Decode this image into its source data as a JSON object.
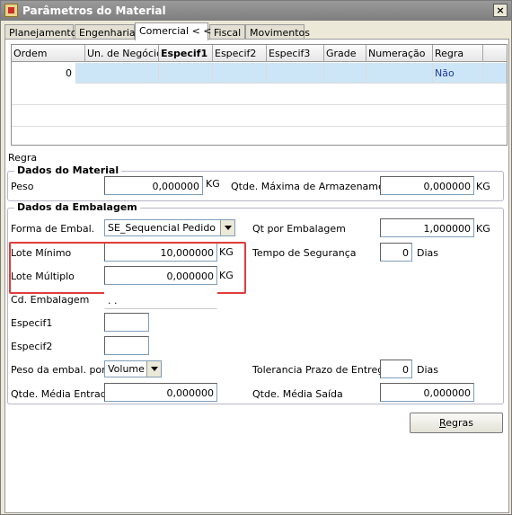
{
  "window": {
    "title": "Parâmetros do Material",
    "close_label": "×"
  },
  "tabs": [
    {
      "label": "Planejamento"
    },
    {
      "label": "Engenharia"
    },
    {
      "label": "Comercial < <"
    },
    {
      "label": "Fiscal"
    },
    {
      "label": "Movimentos"
    }
  ],
  "grid": {
    "columns": [
      "Ordem",
      "Un. de Negócio",
      "Especif1",
      "Especif2",
      "Especif3",
      "Grade",
      "Numeração",
      "Regra"
    ],
    "rows": [
      {
        "ordem": "0",
        "un_negocio": "",
        "especif1": "",
        "especif2": "",
        "especif3": "",
        "grade": "",
        "numeracao": "",
        "regra": "Não"
      }
    ]
  },
  "regra_label": "Regra",
  "dados_material": {
    "title": "Dados do Material",
    "peso_label": "Peso",
    "peso_value": "0,000000",
    "peso_unit": "KG",
    "qtde_max_label": "Qtde. Máxima de Armazenamento",
    "qtde_max_value": "0,000000",
    "qtde_max_unit": "KG"
  },
  "dados_embalagem": {
    "title": "Dados da Embalagem",
    "forma_label": "Forma de Embal.",
    "forma_value": "SE_Sequencial Pedido",
    "qt_por_embalagem_label": "Qt por Embalagem",
    "qt_por_embalagem_value": "1,000000",
    "qt_por_embalagem_unit": "KG",
    "lote_minimo_label": "Lote Mínimo",
    "lote_minimo_value": "10,000000",
    "lote_minimo_unit": "KG",
    "tempo_seguranca_label": "Tempo de Segurança",
    "tempo_seguranca_value": "0",
    "tempo_seguranca_unit": "Dias",
    "lote_multiplo_label": "Lote Múltiplo",
    "lote_multiplo_value": "0,000000",
    "lote_multiplo_unit": "KG",
    "cd_embalagem_label": "Cd. Embalagem",
    "cd_embalagem_value": " .   .",
    "especif1_label": "Especif1",
    "especif1_value": "",
    "especif2_label": "Especif2",
    "especif2_value": "",
    "peso_embal_label": "Peso da embal. por",
    "peso_embal_value": "Volume",
    "tolerancia_label": "Tolerancia Prazo de Entrega",
    "tolerancia_value": "0",
    "tolerancia_unit": "Dias",
    "qtde_media_entrada_label": "Qtde. Média Entrada",
    "qtde_media_entrada_value": "0,000000",
    "qtde_media_saida_label": "Qtde. Média Saída",
    "qtde_media_saida_value": "0,000000"
  },
  "regras_button": {
    "underlined": "R",
    "rest": "egras"
  },
  "colors": {
    "highlight": "#e03c3c",
    "selected_row": "#cde6f7",
    "titlebar": "#8a8a8a"
  }
}
